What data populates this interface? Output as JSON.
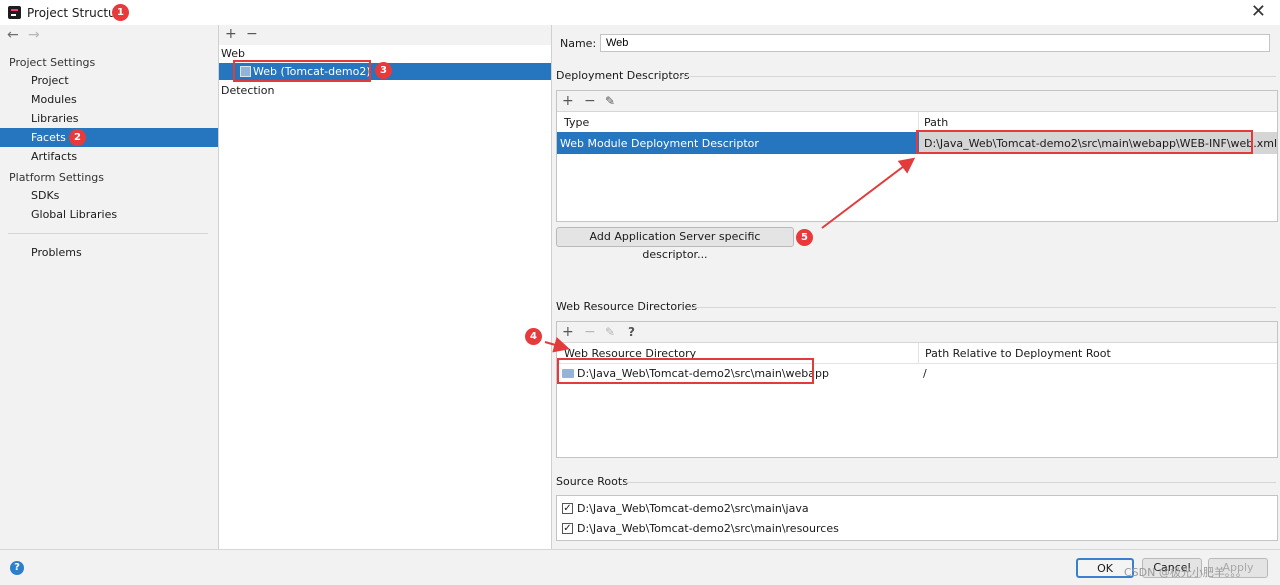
{
  "window": {
    "title": "Project Structure",
    "close_label": "✕"
  },
  "annotations": {
    "b1": "1",
    "b2": "2",
    "b3": "3",
    "b4": "4",
    "b5": "5"
  },
  "nav": {
    "back": "←",
    "forward": "→"
  },
  "sidebar": {
    "project_settings": "Project Settings",
    "items": [
      {
        "label": "Project"
      },
      {
        "label": "Modules"
      },
      {
        "label": "Libraries"
      },
      {
        "label": "Facets"
      },
      {
        "label": "Artifacts"
      }
    ],
    "platform_settings": "Platform Settings",
    "platform_items": [
      {
        "label": "SDKs"
      },
      {
        "label": "Global Libraries"
      }
    ],
    "problems": "Problems"
  },
  "facets_tree": {
    "add": "+",
    "remove": "−",
    "group_web": "Web",
    "selected_item": "Web (Tomcat-demo2)",
    "group_detection": "Detection"
  },
  "details": {
    "name_label": "Name:",
    "name_value": "Web",
    "deployment": {
      "title": "Deployment Descriptors",
      "tool_add": "+",
      "tool_remove": "−",
      "tool_edit": "✎",
      "col_type": "Type",
      "col_path": "Path",
      "row_type": "Web Module Deployment Descriptor",
      "row_path": "D:\\Java_Web\\Tomcat-demo2\\src\\main\\webapp\\WEB-INF\\web.xml",
      "add_server_button": "Add Application Server specific descriptor..."
    },
    "resources": {
      "title": "Web Resource Directories",
      "tool_add": "+",
      "tool_remove": "−",
      "tool_edit": "✎",
      "tool_help": "?",
      "col_dir": "Web Resource Directory",
      "col_rel": "Path Relative to Deployment Root",
      "row_dir": "D:\\Java_Web\\Tomcat-demo2\\src\\main\\webapp",
      "row_rel": "/"
    },
    "source_roots": {
      "title": "Source Roots",
      "items": [
        {
          "path": "D:\\Java_Web\\Tomcat-demo2\\src\\main\\java",
          "checked": "✓"
        },
        {
          "path": "D:\\Java_Web\\Tomcat-demo2\\src\\main\\resources",
          "checked": "✓"
        }
      ]
    }
  },
  "footer": {
    "help": "?",
    "ok": "OK",
    "cancel": "Cancel",
    "apply": "Apply",
    "watermark": "CSDN @极光小肥羊。。。"
  },
  "colors": {
    "selection": "#2675bf",
    "annotation_red": "#e33b3b"
  }
}
